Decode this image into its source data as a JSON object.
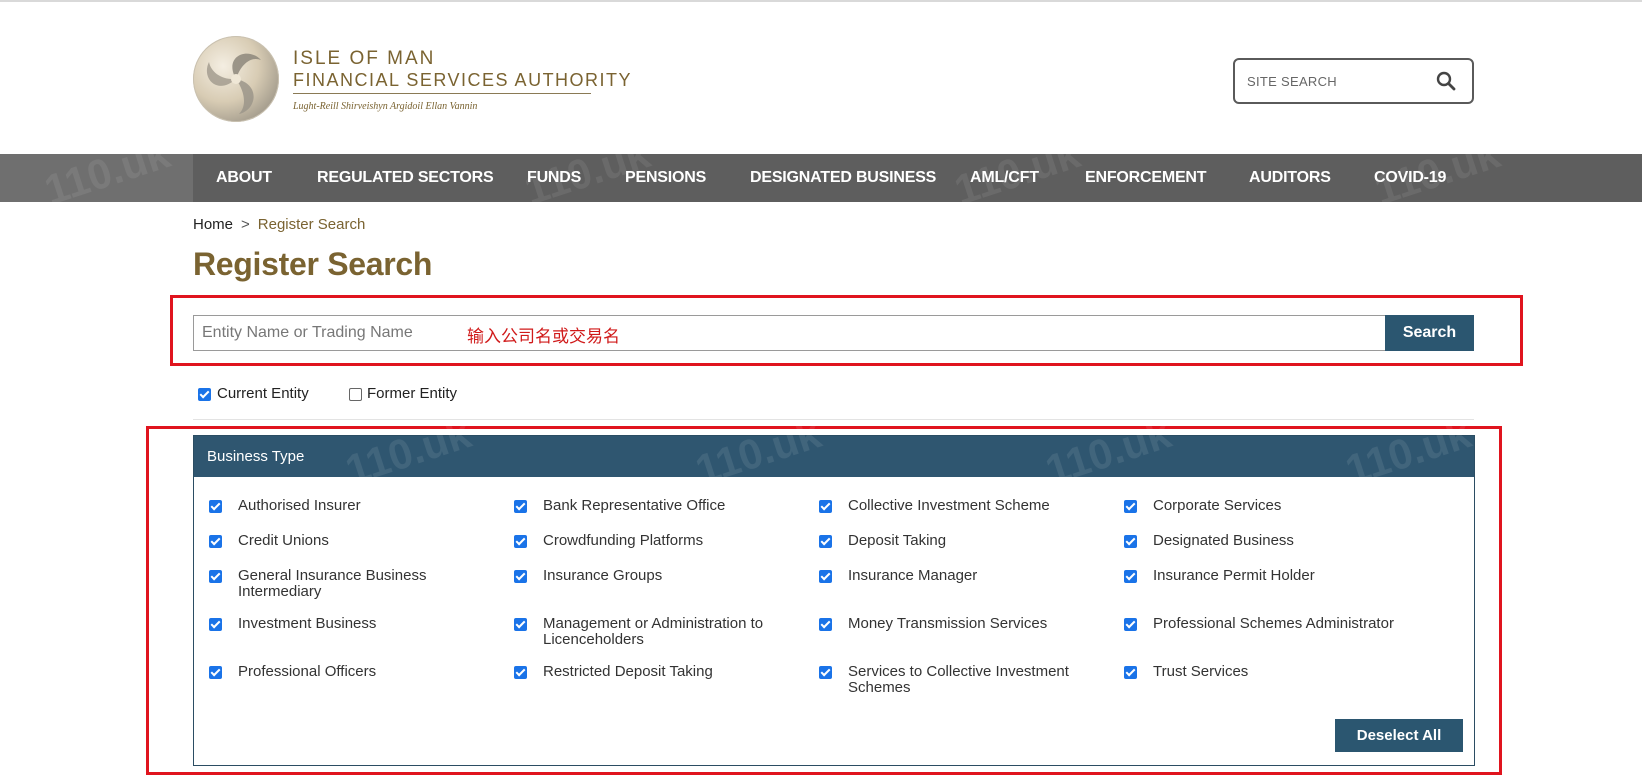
{
  "header": {
    "logo": {
      "line1": "ISLE OF MAN",
      "line2": "FINANCIAL SERVICES AUTHORITY",
      "line3": "Lught-Reill Shirveishyn Argidoil Ellan Vannin"
    },
    "site_search": {
      "placeholder": "SITE SEARCH",
      "icon": "search-icon"
    }
  },
  "nav": {
    "items": [
      "ABOUT",
      "REGULATED SECTORS",
      "FUNDS",
      "PENSIONS",
      "DESIGNATED BUSINESS",
      "AML/CFT",
      "ENFORCEMENT",
      "AUDITORS",
      "COVID-19"
    ]
  },
  "breadcrumb": {
    "home": "Home",
    "separator": ">",
    "current": "Register Search"
  },
  "page_title": "Register Search",
  "search": {
    "placeholder": "Entity Name or Trading Name",
    "annotation": "输入公司名或交易名",
    "button_label": "Search"
  },
  "entity_filter": {
    "current": {
      "label": "Current Entity",
      "checked": true
    },
    "former": {
      "label": "Former Entity",
      "checked": false
    }
  },
  "business_type": {
    "header": "Business Type",
    "items": [
      "Authorised Insurer",
      "Bank Representative Office",
      "Collective Investment Scheme",
      "Corporate Services",
      "Credit Unions",
      "Crowdfunding Platforms",
      "Deposit Taking",
      "Designated Business",
      "General Insurance Business Intermediary",
      "Insurance Groups",
      "Insurance Manager",
      "Insurance Permit Holder",
      "Investment Business",
      "Management or Administration to Licenceholders",
      "Money Transmission Services",
      "Professional Schemes Administrator",
      "Professional Officers",
      "Restricted Deposit Taking",
      "Services to Collective Investment Schemes",
      "Trust Services"
    ],
    "all_checked": true,
    "deselect_label": "Deselect All"
  },
  "colors": {
    "brand_gold": "#7a6331",
    "nav_bg": "#5e5e5e",
    "primary_button": "#2b5670",
    "panel_header": "#2f5670",
    "annotation_red": "#e0141e",
    "checkbox_blue": "#1a73e8"
  }
}
